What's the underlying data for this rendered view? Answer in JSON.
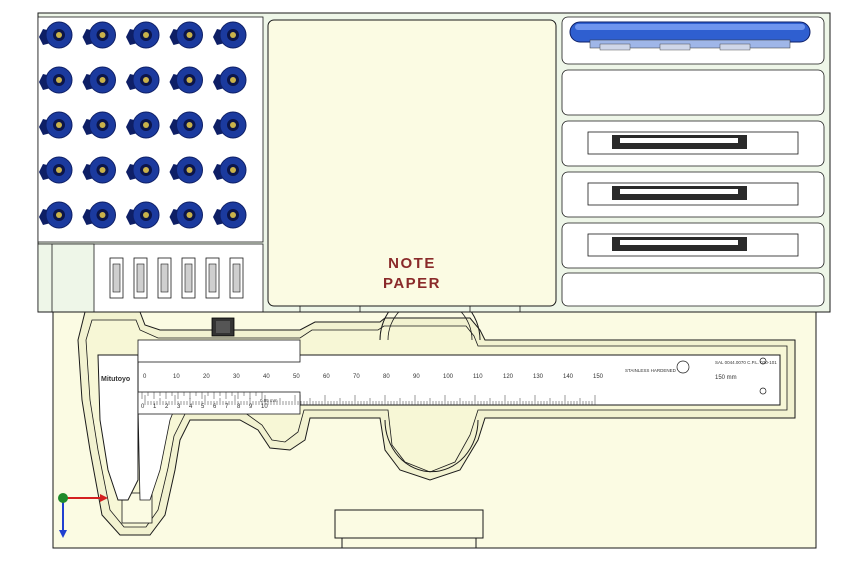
{
  "colors": {
    "background": "#ffffff",
    "part_fill": "#fbfbe3",
    "part_edge": "#1a1a1a",
    "tray_fill": "#eef6e8",
    "screw_blue": "#1b3a9e",
    "screw_dark": "#0e1f66",
    "axis_x": "#d42020",
    "axis_y": "#1f8a2a",
    "axis_z": "#2040d0",
    "note_text": "#8a2a2a"
  },
  "note_paper": {
    "line1": "NOTE",
    "line2": "PAPER"
  },
  "caliper": {
    "brand": "Mitutoyo",
    "main_scale_labels": [
      "0",
      "10",
      "20",
      "30",
      "40",
      "50",
      "60",
      "70",
      "80",
      "90",
      "100",
      "110",
      "120",
      "130",
      "140",
      "150"
    ],
    "vernier_labels": [
      "0",
      "1",
      "2",
      "3",
      "4",
      "5",
      "6",
      "7",
      "8",
      "9",
      "10"
    ],
    "vernier_resolution": "0.05 mm",
    "stainless_text": "STAINLESS HARDENED",
    "range_text": "150 mm",
    "model_text": "SAL 0044.0070 C.P.L. 030-101"
  },
  "screw_grid": {
    "rows": 5,
    "cols": 5
  },
  "sockets": {
    "count": 6
  },
  "tool_slots": [
    {
      "name": "slot-1"
    },
    {
      "name": "slot-2"
    },
    {
      "name": "slot-3"
    },
    {
      "name": "slot-4"
    },
    {
      "name": "slot-5"
    },
    {
      "name": "slot-6"
    }
  ],
  "axis_icon": "xyz-triad-icon"
}
